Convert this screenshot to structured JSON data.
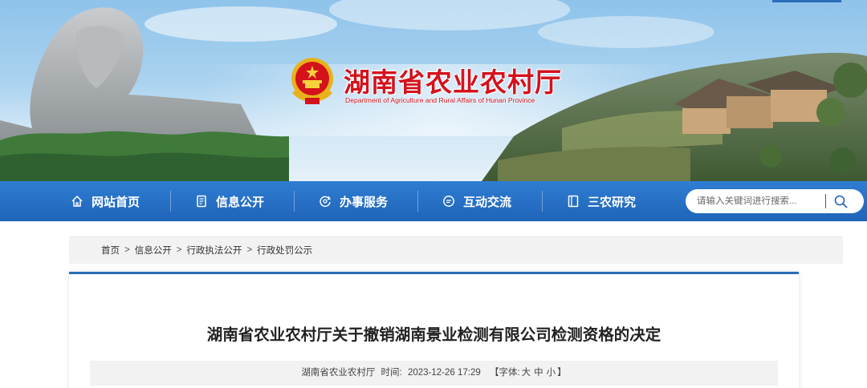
{
  "header": {
    "site_title": "湖南省农业农村厅",
    "site_subtitle": "Department of Agriculture and Rural Affairs of Hunan Province"
  },
  "nav": {
    "items": [
      {
        "label": "网站首页",
        "icon": "home-icon"
      },
      {
        "label": "信息公开",
        "icon": "document-icon"
      },
      {
        "label": "办事服务",
        "icon": "service-icon"
      },
      {
        "label": "互动交流",
        "icon": "chat-icon"
      },
      {
        "label": "三农研究",
        "icon": "book-icon"
      }
    ]
  },
  "search": {
    "placeholder": "请输入关键词进行搜索...",
    "icon": "search-icon"
  },
  "breadcrumb": {
    "items": [
      "首页",
      "信息公开",
      "行政执法公开",
      "行政处罚公示"
    ],
    "separator": ">"
  },
  "article": {
    "title": "湖南省农业农村厅关于撤销湖南景业检测有限公司检测资格的决定",
    "source": "湖南省农业农村厅",
    "time_label": "时间:",
    "time": "2023-12-26 17:29",
    "font_size_label": "【字体:",
    "font_large": "大",
    "font_medium": "中",
    "font_small": "小",
    "font_close": "】"
  },
  "colors": {
    "nav_blue": "#1f64b8",
    "title_red": "#d4121c",
    "accent": "#2a6db8"
  }
}
